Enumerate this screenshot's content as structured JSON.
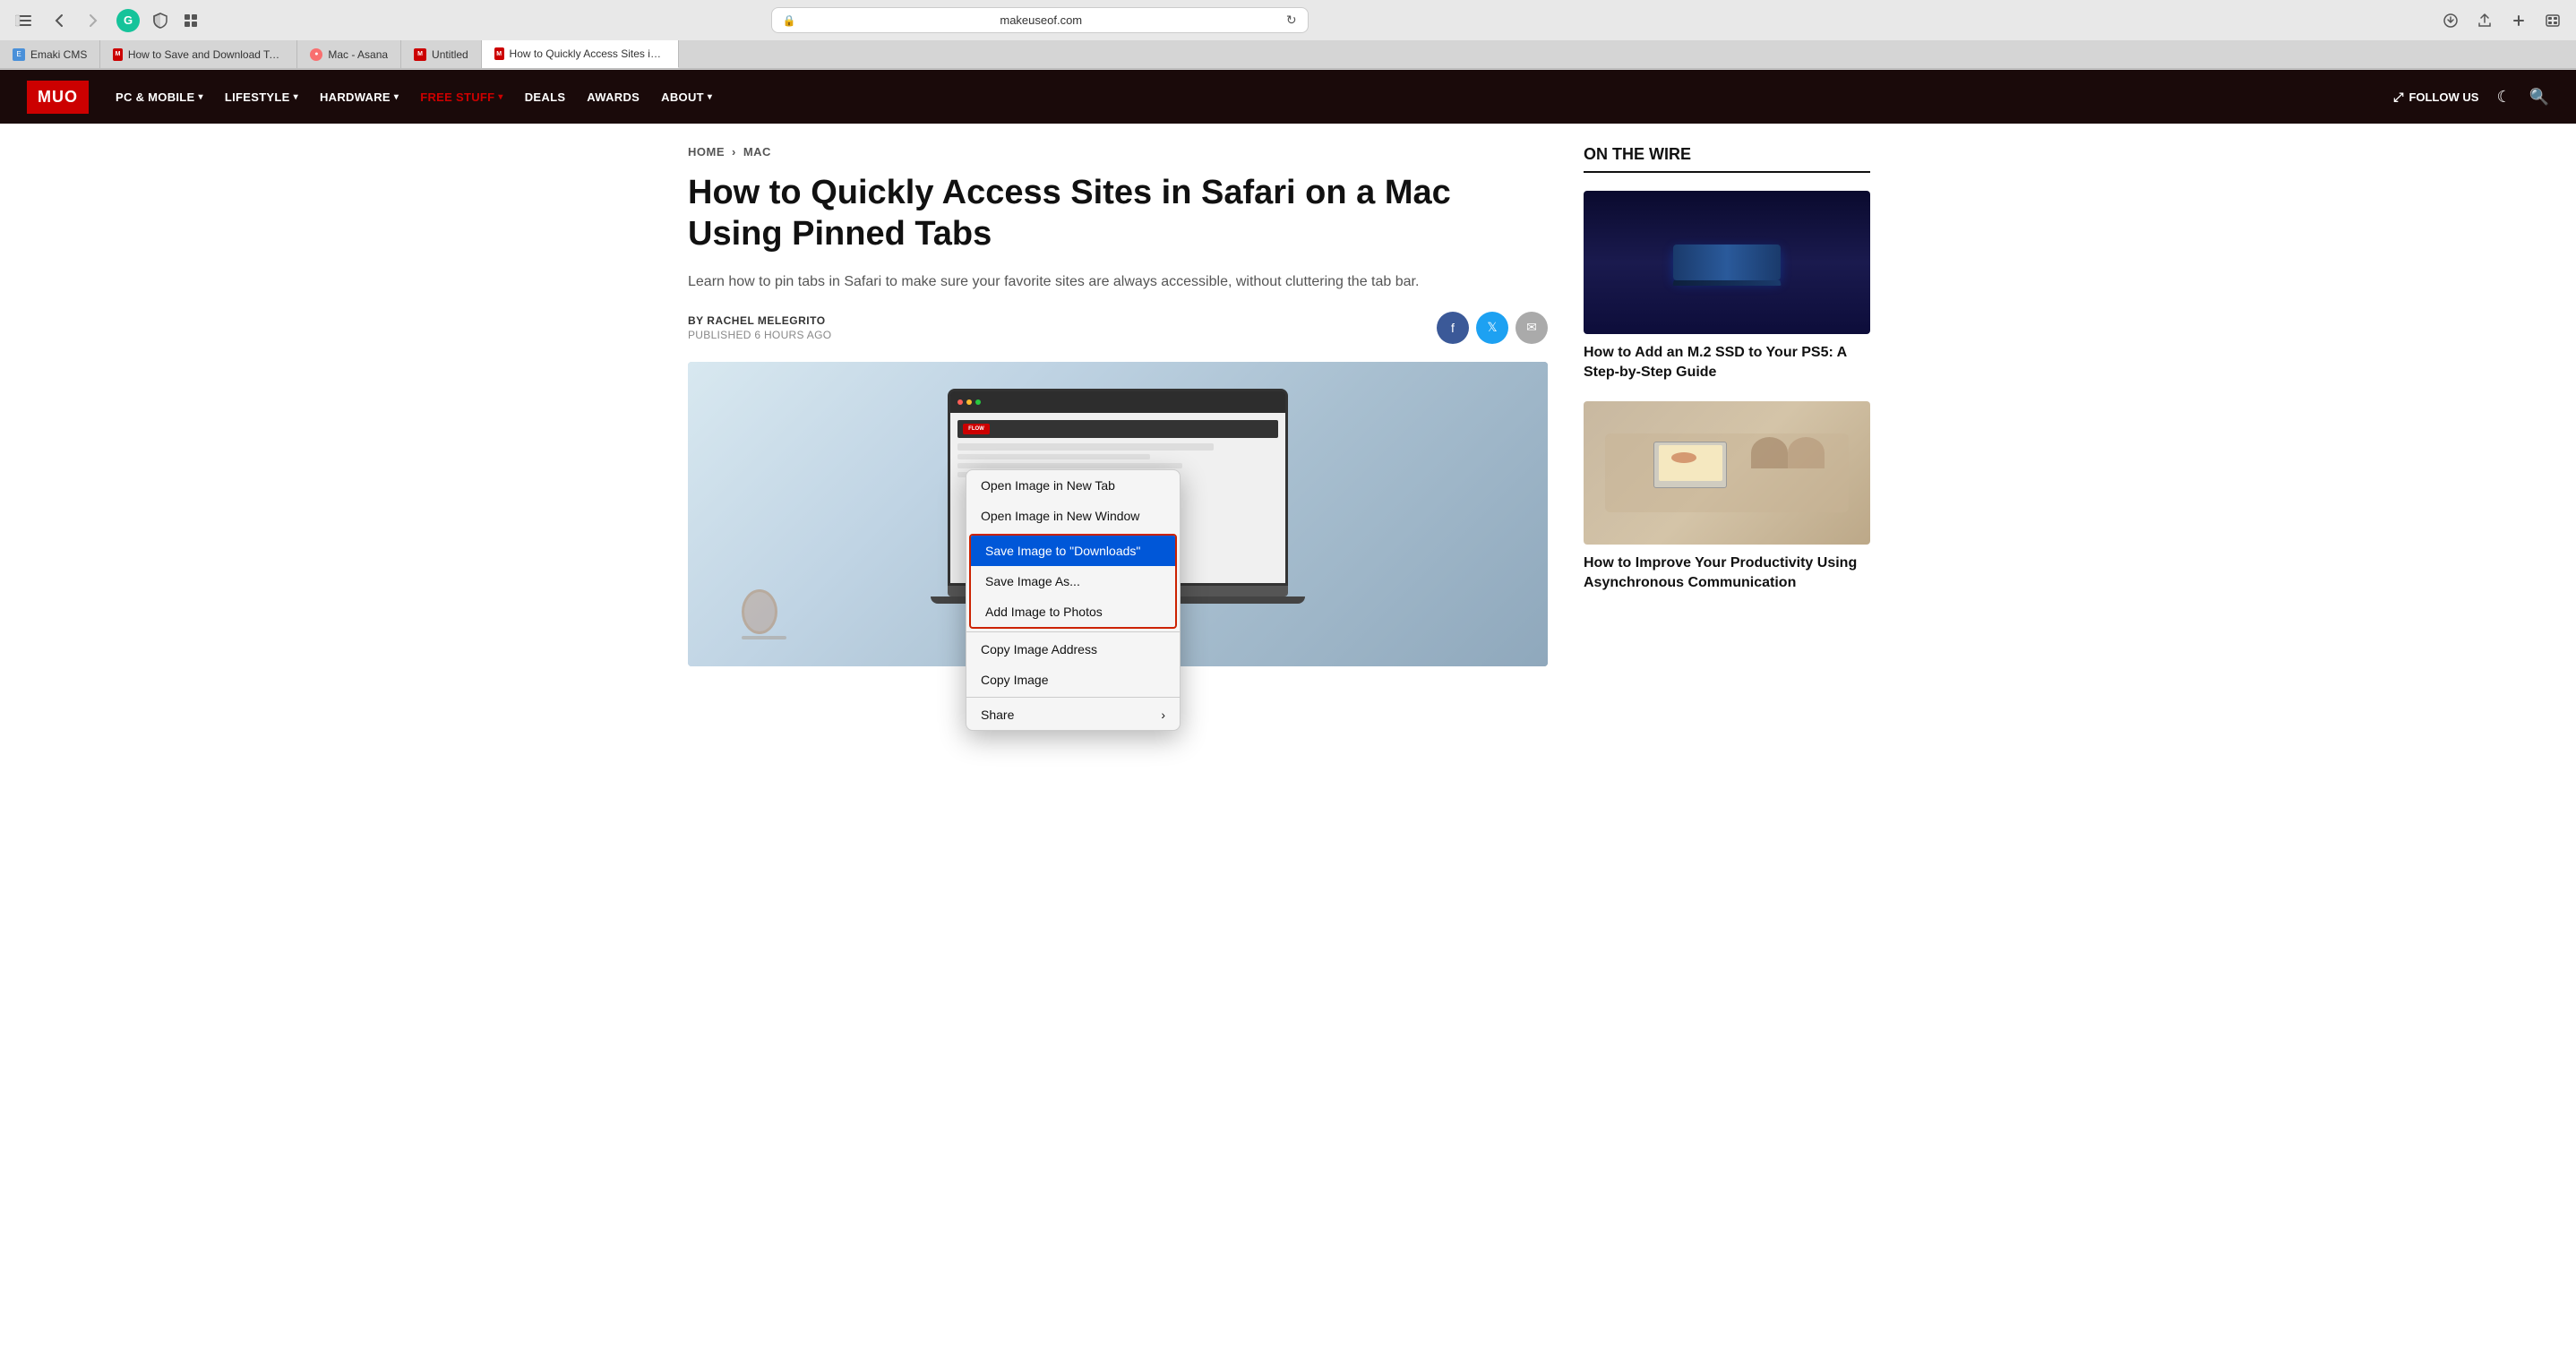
{
  "browser": {
    "address": "makeuseof.com",
    "reload_title": "Reload page"
  },
  "tabs": [
    {
      "id": "emaki",
      "label": "Emaki CMS",
      "favicon_type": "emaki",
      "active": false
    },
    {
      "id": "save-download",
      "label": "How to Save and Download Text, Images,...",
      "favicon_type": "muo",
      "active": false
    },
    {
      "id": "asana",
      "label": "Mac - Asana",
      "favicon_type": "asana",
      "active": false
    },
    {
      "id": "untitled",
      "label": "Untitled",
      "favicon_type": "muo",
      "active": false
    },
    {
      "id": "safari-article",
      "label": "How to Quickly Access Sites in Safari on...",
      "favicon_type": "muo",
      "active": true
    }
  ],
  "nav": {
    "logo": "MUO",
    "items": [
      {
        "id": "pc-mobile",
        "label": "PC & MOBILE",
        "has_dropdown": true
      },
      {
        "id": "lifestyle",
        "label": "LIFESTYLE",
        "has_dropdown": true
      },
      {
        "id": "hardware",
        "label": "HARDWARE",
        "has_dropdown": true
      },
      {
        "id": "free-stuff",
        "label": "FREE STUFF",
        "has_dropdown": true,
        "highlight": true
      },
      {
        "id": "deals",
        "label": "DEALS",
        "has_dropdown": false
      },
      {
        "id": "awards",
        "label": "AWARDS",
        "has_dropdown": false
      },
      {
        "id": "about",
        "label": "ABOUT",
        "has_dropdown": true
      }
    ],
    "follow_us": "FOLLOW US",
    "search_aria": "Search"
  },
  "breadcrumb": {
    "home": "HOME",
    "section": "MAC"
  },
  "article": {
    "title": "How to Quickly Access Sites in Safari on a Mac Using Pinned Tabs",
    "subtitle": "Learn how to pin tabs in Safari to make sure your favorite sites are always accessible, without cluttering the tab bar.",
    "author_label": "BY",
    "author": "RACHEL MELEGRITO",
    "published": "PUBLISHED 6 HOURS AGO"
  },
  "social": {
    "facebook_aria": "Share on Facebook",
    "twitter_aria": "Share on Twitter",
    "email_aria": "Share via Email"
  },
  "context_menu": {
    "items": [
      {
        "id": "open-new-tab",
        "label": "Open Image in New Tab",
        "highlighted": false,
        "has_arrow": false
      },
      {
        "id": "open-new-window",
        "label": "Open Image in New Window",
        "highlighted": false,
        "has_arrow": false
      },
      {
        "id": "save-downloads",
        "label": "Save Image to \"Downloads\"",
        "highlighted": true,
        "in_group": true,
        "has_arrow": false
      },
      {
        "id": "save-as",
        "label": "Save Image As...",
        "highlighted": false,
        "in_group": true,
        "has_arrow": false
      },
      {
        "id": "add-photos",
        "label": "Add Image to Photos",
        "highlighted": false,
        "in_group": true,
        "has_arrow": false
      },
      {
        "id": "copy-address",
        "label": "Copy Image Address",
        "highlighted": false,
        "has_arrow": false
      },
      {
        "id": "copy-image",
        "label": "Copy Image",
        "highlighted": false,
        "has_arrow": false
      },
      {
        "id": "share",
        "label": "Share",
        "highlighted": false,
        "has_arrow": true
      }
    ]
  },
  "sidebar": {
    "title": "ON THE WIRE",
    "articles": [
      {
        "id": "ps5-ssd",
        "image_type": "ssd",
        "title": "How to Add an M.2 SSD to Your PS5: A Step-by-Step Guide"
      },
      {
        "id": "async-productivity",
        "image_type": "meeting",
        "title": "How to Improve Your Productivity Using Asynchronous Communication"
      }
    ]
  },
  "laptop_site": {
    "logo": "FLOW"
  }
}
